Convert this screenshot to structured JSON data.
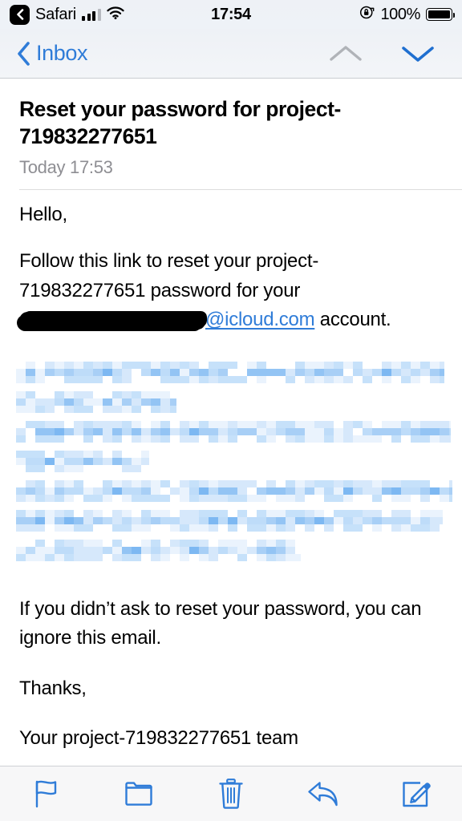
{
  "status_bar": {
    "back_app_label": "Safari",
    "back_chip_icon": "chevron-left-icon",
    "signal_icon": "cellular-signal-icon",
    "wifi_icon": "wifi-icon",
    "time": "17:54",
    "rotation_lock_icon": "rotation-lock-icon",
    "battery_percent": "100%",
    "battery_icon": "battery-full-icon"
  },
  "nav_bar": {
    "back_label": "Inbox",
    "back_icon": "chevron-left-icon",
    "previous_message_icon": "chevron-up-icon",
    "next_message_icon": "chevron-down-icon",
    "accent_color": "#2f7cd8",
    "disabled_color": "#b0b3b8"
  },
  "message": {
    "subject": "Reset your password for project-719832277651",
    "timestamp": "Today 17:53",
    "greeting": "Hello,",
    "instruction_prefix": "Follow this link to reset your project-719832277651 password for your ",
    "redacted_email_user": "",
    "email_domain": "@icloud.com",
    "instruction_suffix": " account.",
    "redacted_link_note": "",
    "disclaimer": "If you didn’t ask to reset your password, you can ignore this email.",
    "thanks": "Thanks,",
    "signature": "Your project-719832277651 team"
  },
  "toolbar": {
    "flag_label": "Flag",
    "flag_icon": "flag-icon",
    "move_label": "Move",
    "move_icon": "folder-icon",
    "delete_label": "Delete",
    "delete_icon": "trash-icon",
    "reply_label": "Reply",
    "reply_icon": "reply-arrow-icon",
    "compose_label": "Compose",
    "compose_icon": "compose-icon",
    "icon_color": "#2f7cd8"
  }
}
